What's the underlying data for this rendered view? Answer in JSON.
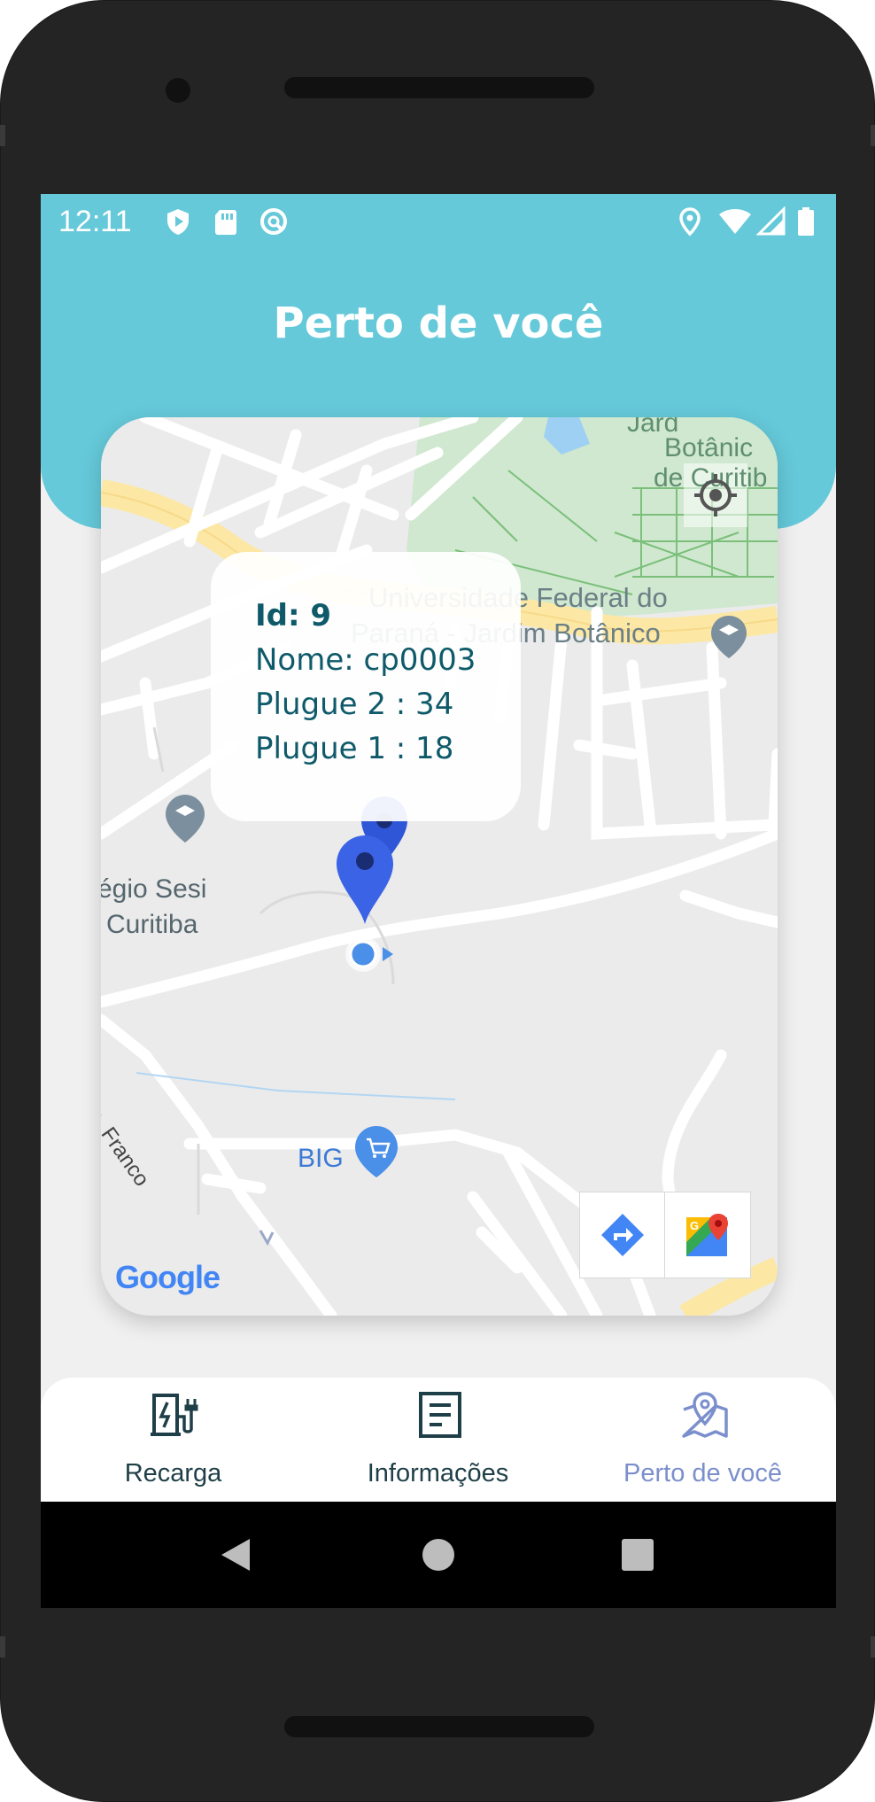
{
  "status_bar": {
    "time": "12:11",
    "icons": [
      "shield-icon",
      "sd-card-icon",
      "sync-icon",
      "location-icon",
      "wifi-icon",
      "signal-icon",
      "battery-icon"
    ]
  },
  "header": {
    "title": "Perto de você",
    "color": "#65c9d9"
  },
  "map": {
    "labels": {
      "university_line1": "Universidade Federal do",
      "university_line2": "Paraná - Jardim Botânico",
      "botanic_line1": "Botânic",
      "botanic_line2": "de Curitib",
      "school_line1": "égio Sesi",
      "school_line2": "Curitiba",
      "street": "Com. Franco",
      "store": "BIG",
      "google_logo": "Google"
    },
    "info_window": {
      "id": "Id: 9",
      "name": "Nome: cp0003",
      "plug2": "Plugue 2 : 34",
      "plug1": "Plugue 1 : 18"
    },
    "markers": [
      "charging-station-marker",
      "charging-station-marker"
    ],
    "buttons": [
      "my-location-button",
      "directions-button",
      "google-maps-button"
    ]
  },
  "bottom_nav": {
    "items": [
      {
        "label": "Recarga",
        "icon": "ev-charger-icon",
        "active": false
      },
      {
        "label": "Informações",
        "icon": "document-icon",
        "active": false
      },
      {
        "label": "Perto de você",
        "icon": "map-pin-icon",
        "active": true
      }
    ],
    "active_color": "#7b8fcc",
    "inactive_color": "#1f3f48"
  },
  "system_nav": [
    "back-button",
    "home-button",
    "recents-button"
  ]
}
